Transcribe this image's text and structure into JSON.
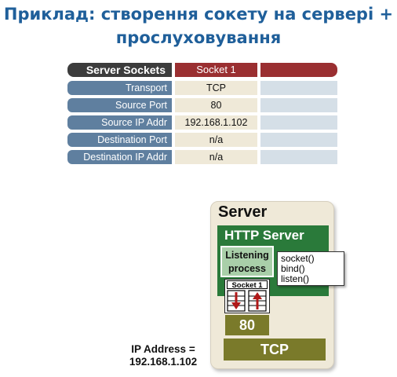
{
  "title": {
    "line1": "Приклад: створення сокету на сервері +",
    "line2": "прослуховування"
  },
  "table": {
    "header": {
      "label": "Server Sockets",
      "socket": "Socket 1",
      "extra": ""
    },
    "rows": [
      {
        "label": "Transport",
        "value": "TCP"
      },
      {
        "label": "Source Port",
        "value": "80"
      },
      {
        "label": "Source IP Addr",
        "value": "192.168.1.102"
      },
      {
        "label": "Destination Port",
        "value": "n/a"
      },
      {
        "label": "Destination IP Addr",
        "value": "n/a"
      }
    ]
  },
  "diagram": {
    "server_title": "Server",
    "http_title": "HTTP Server",
    "listening_line1": "Listening",
    "listening_line2": "process",
    "calls": [
      "socket()",
      "bind()",
      "listen()"
    ],
    "socket_label": "Socket 1",
    "port": "80",
    "transport": "TCP",
    "ip_line1": "IP Address =",
    "ip_line2": "192.168.1.102"
  },
  "colors": {
    "title": "#1f5f9a",
    "header_dark": "#3c3c3c",
    "header_red": "#9a2f31",
    "row_label": "#5f7f9f",
    "http_green": "#2a7a3a",
    "olive": "#7a7a2a",
    "arrow_red": "#b01818"
  }
}
